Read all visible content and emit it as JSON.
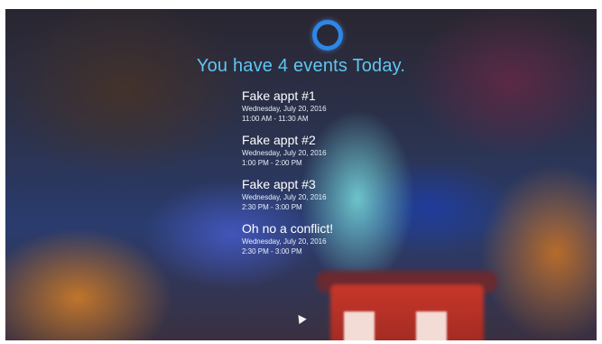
{
  "header": {
    "assistant_icon": "cortana-ring-icon",
    "summary": "You have 4 events Today."
  },
  "events": [
    {
      "title": "Fake appt #1",
      "date": "Wednesday, July 20, 2016",
      "time": "11:00 AM - 11:30 AM"
    },
    {
      "title": "Fake appt #2",
      "date": "Wednesday, July 20, 2016",
      "time": "1:00 PM - 2:00 PM"
    },
    {
      "title": "Fake appt #3",
      "date": "Wednesday, July 20, 2016",
      "time": "2:30 PM - 3:00 PM"
    },
    {
      "title": "Oh no a conflict!",
      "date": "Wednesday, July 20, 2016",
      "time": "2:30 PM - 3:00 PM"
    }
  ],
  "colors": {
    "accent": "#2f86e6",
    "headline": "#5fc6f2",
    "event_text": "#ffffff"
  }
}
